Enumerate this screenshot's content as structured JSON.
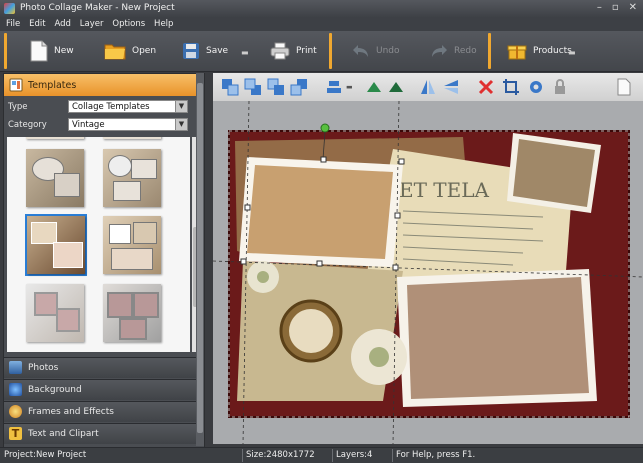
{
  "window": {
    "title": "Photo Collage Maker - New Project"
  },
  "menu": [
    "File",
    "Edit",
    "Add",
    "Layer",
    "Options",
    "Help"
  ],
  "toolbar": {
    "new": "New",
    "open": "Open",
    "save": "Save",
    "print": "Print",
    "undo": "Undo",
    "redo": "Redo",
    "products": "Products"
  },
  "left_panel": {
    "header": "Templates",
    "type_label": "Type",
    "type_value": "Collage Templates",
    "category_label": "Category",
    "category_value": "Vintage",
    "sections": [
      "Photos",
      "Background",
      "Frames and Effects",
      "Text and Clipart"
    ]
  },
  "canvas": {
    "postcard_text": "ET TELA"
  },
  "status": {
    "project": "Project:New Project",
    "size": "Size:2480x1772",
    "layers": "Layers:4",
    "help": "For Help, press F1."
  },
  "colors": {
    "accent": "#f0a830",
    "frame_bg": "#6b1a1a"
  }
}
